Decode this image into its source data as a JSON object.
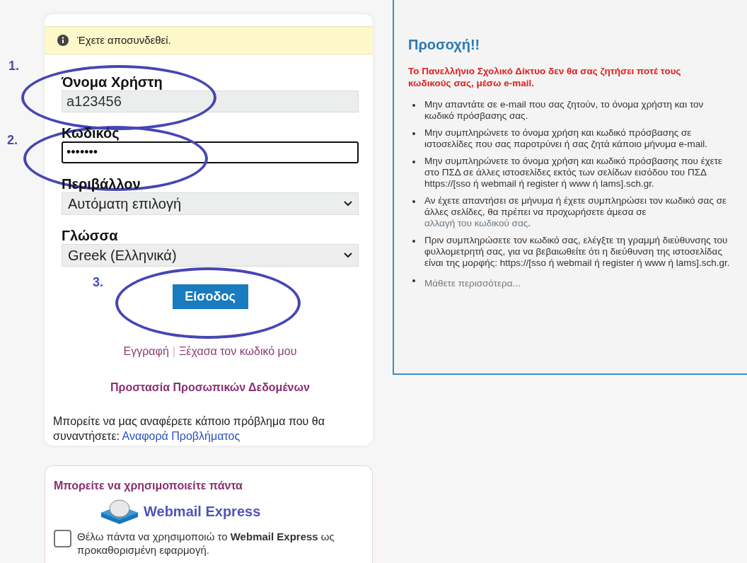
{
  "notice": {
    "text": "Έχετε αποσυνδεθεί."
  },
  "form": {
    "fields": [
      {
        "kind": "text",
        "label": "Όνομα Χρήστη",
        "value": "a123456"
      },
      {
        "kind": "password",
        "label": "Κωδικός",
        "value": "•••••••"
      },
      {
        "kind": "select",
        "label": "Περιβάλλον",
        "value": "Αυτόματη επιλογή"
      },
      {
        "kind": "select",
        "label": "Γλώσσα",
        "value": "Greek (Ελληνικά)"
      }
    ],
    "submit": "Είσοδος"
  },
  "links": [
    "Εγγραφή",
    "Ξέχασα τον κωδικό μου"
  ],
  "separator": "|",
  "privacy_link": "Προστασία Προσωπικών Δεδομένων",
  "report": {
    "text": "Μπορείτε να μας αναφέρετε κάποιο πρόβλημα που θα συναντήσετε:",
    "link": "Αναφορά Προβλήματος"
  },
  "webmail": {
    "heading": "Μπορείτε να χρησιμοποιείτε πάντα",
    "app_name": "Webmail Express",
    "checkbox": {
      "label": "Θέλω πάντα να χρησιμοποιώ το **Webmail Express** ως προκαθορισμένη εφαρμογή.",
      "checked": false
    }
  },
  "annotations": [
    {
      "label": "1."
    },
    {
      "label": "2."
    },
    {
      "label": "3."
    }
  ],
  "warning": {
    "title": "Προσοχή!!",
    "lead": "Το Πανελλήνιο Σχολικό Δίκτυο δεν θα σας ζητήσει ποτέ τους κωδικούς σας, μέσω e-mail.",
    "items": [
      {
        "text": "Μην απαντάτε σε e-mail που σας ζητούν, το όνομα χρήστη και τον κωδικό πρόσβασης σας."
      },
      {
        "text": "Μην συμπληρώνετε το όνομα χρήση και κωδικό πρόσβασης σε ιστοσελίδες που σας παροτρύνει ή σας ζητά κάποιο μήνυμα e-mail."
      },
      {
        "text": "Μην συμπληρώνετε το όνομα χρήση και κωδικό πρόσβασης που έχετε στο ΠΣΔ σε άλλες ιστοσελίδες εκτός των σελίδων εισόδου του ΠΣΔ https://[sso ή webmail ή register ή www ή lams].sch.gr."
      },
      {
        "text": "Αν έχετε απαντήσει σε μήνυμα ή έχετε συμπληρώσει τον κωδικό σας σε άλλες σελίδες, θα πρέπει να προχωρήσετε άμεσα σε ",
        "link": "αλλαγή του κωδικού σας",
        "after": "."
      },
      {
        "text": "Πριν συμπληρώσετε τον κωδικό σας, ελέγξτε τη γραμμή διεύθυνσης του φυλλομετρητή σας, για να βεβαιωθείτε ότι η διεύθυνση της ιστοσελίδας είναι της μορφής: https://[sso ή webmail ή register ή www ή lams].sch.gr."
      }
    ],
    "more": "Μάθετε περισσότερα..."
  }
}
